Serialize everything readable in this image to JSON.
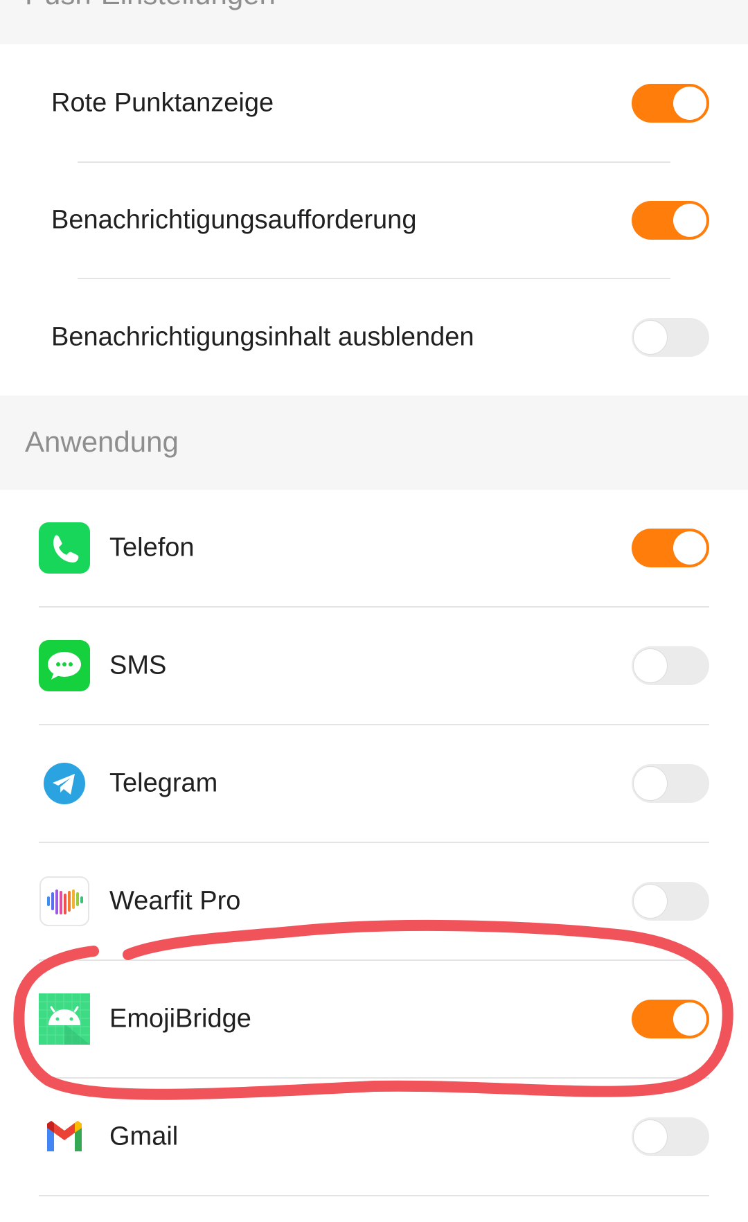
{
  "push_section": {
    "title": "Push-Einstellungen",
    "rows": [
      {
        "label": "Rote Punktanzeige",
        "enabled": true
      },
      {
        "label": "Benachrichtigungsaufforderung",
        "enabled": true
      },
      {
        "label": "Benachrichtigungsinhalt ausblenden",
        "enabled": false
      }
    ]
  },
  "app_section": {
    "title": "Anwendung",
    "apps": [
      {
        "label": "Telefon",
        "icon": "phone-icon",
        "enabled": true
      },
      {
        "label": "SMS",
        "icon": "sms-icon",
        "enabled": false
      },
      {
        "label": "Telegram",
        "icon": "telegram-icon",
        "enabled": false
      },
      {
        "label": "Wearfit Pro",
        "icon": "wearfit-icon",
        "enabled": false
      },
      {
        "label": "EmojiBridge",
        "icon": "android-icon",
        "enabled": true
      },
      {
        "label": "Gmail",
        "icon": "gmail-icon",
        "enabled": false
      }
    ]
  },
  "colors": {
    "accent": "#ff7d0a",
    "toggle_off": "#ebebeb",
    "section_bg": "#f6f6f6",
    "annotation": "#f0535a"
  }
}
